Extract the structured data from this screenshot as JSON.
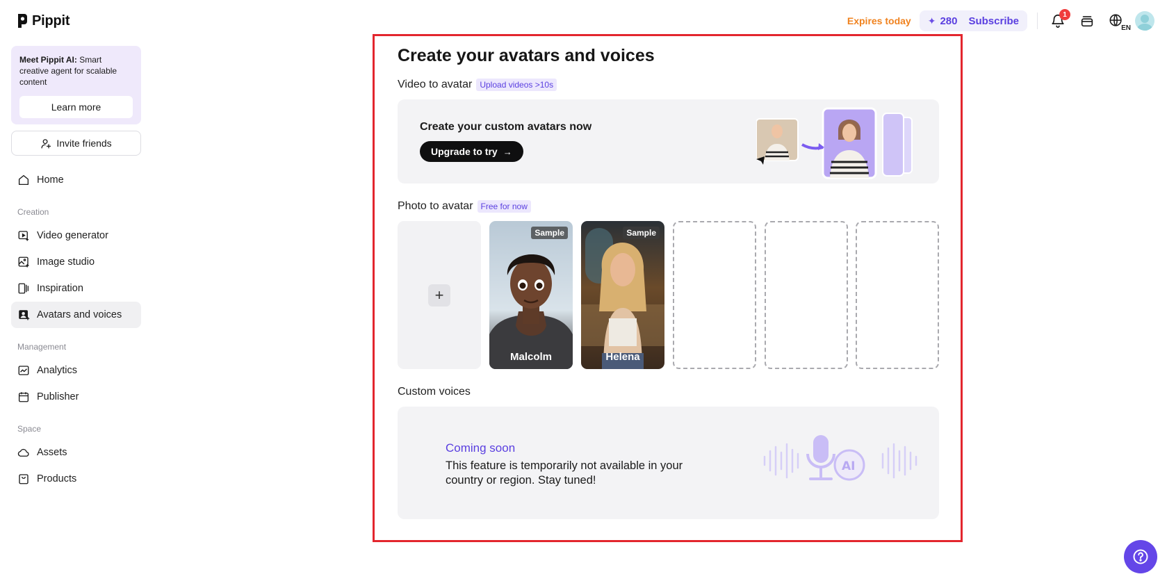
{
  "brand": {
    "name": "Pippit"
  },
  "topbar": {
    "expires": "Expires today",
    "credits": "280",
    "subscribe": "Subscribe",
    "notification_count": "1",
    "language": "EN",
    "accent": "#5a3fe0",
    "expires_color": "#f0821e"
  },
  "sidebar": {
    "promo": {
      "bold": "Meet Pippit AI:",
      "text": " Smart creative agent for scalable content",
      "cta": "Learn more"
    },
    "invite": "Invite friends",
    "home": "Home",
    "sections": {
      "creation": "Creation",
      "management": "Management",
      "space": "Space"
    },
    "creation_items": [
      "Video generator",
      "Image studio",
      "Inspiration",
      "Avatars and voices"
    ],
    "management_items": [
      "Analytics",
      "Publisher"
    ],
    "space_items": [
      "Assets",
      "Products"
    ],
    "active_item": "Avatars and voices"
  },
  "main": {
    "title": "Create your avatars and voices",
    "video_to_avatar": {
      "label": "Video to avatar",
      "tag": "Upload videos >10s",
      "card_title": "Create your custom avatars now",
      "cta": "Upgrade to try"
    },
    "photo_to_avatar": {
      "label": "Photo to avatar",
      "tag": "Free for now",
      "samples": [
        {
          "tag": "Sample",
          "name": "Malcolm"
        },
        {
          "tag": "Sample",
          "name": "Helena"
        }
      ]
    },
    "custom_voices": {
      "label": "Custom voices",
      "status": "Coming soon",
      "message": "This feature is temporarily not available in your country or region. Stay tuned!"
    }
  },
  "help": {
    "icon": "question-icon"
  }
}
